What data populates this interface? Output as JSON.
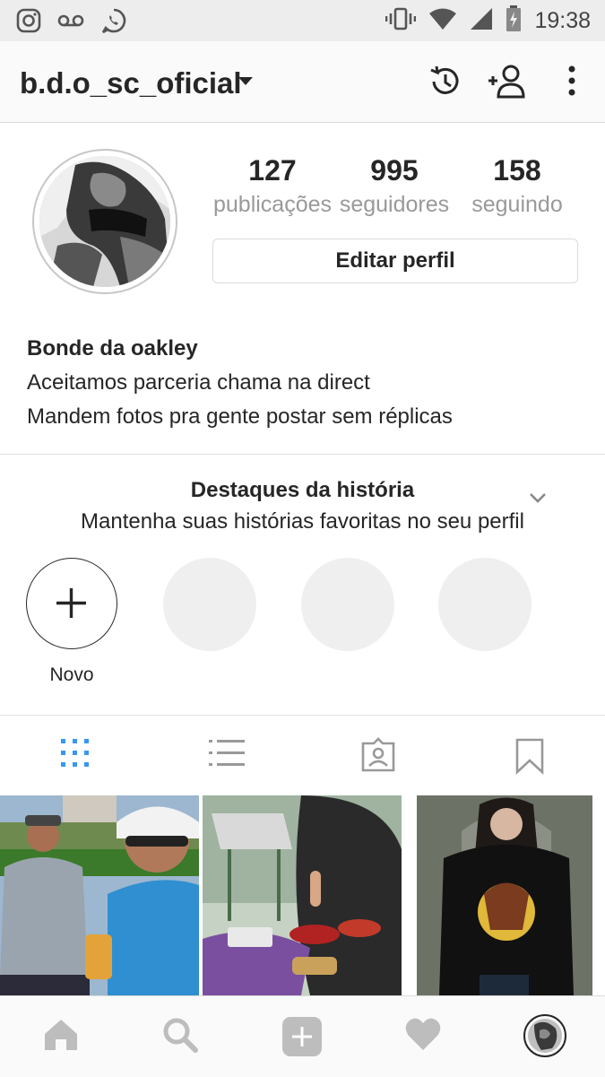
{
  "status_bar": {
    "time": "19:38",
    "left_icons": [
      "instagram-icon",
      "voicemail-icon",
      "whatsapp-icon"
    ],
    "right_icons": [
      "vibrate-icon",
      "wifi-icon",
      "signal-icon",
      "battery-icon"
    ]
  },
  "toolbar": {
    "username": "b.d.o_sc_oficial",
    "icons": [
      "account-switch-caret-icon",
      "archive-history-icon",
      "add-person-icon",
      "more-options-icon"
    ]
  },
  "profile": {
    "stats": [
      {
        "count": "127",
        "label": "publicações"
      },
      {
        "count": "995",
        "label": "seguidores"
      },
      {
        "count": "158",
        "label": "seguindo"
      }
    ],
    "edit_button": "Editar perfil",
    "display_name": "Bonde da oakley",
    "bio_lines": [
      "Aceitamos parceria chama na direct",
      "Mandem fotos pra gente postar sem réplicas"
    ]
  },
  "highlights": {
    "title": "Destaques da história",
    "subtitle": "Mantenha suas histórias favoritas no seu perfil",
    "new_label": "Novo"
  },
  "tabs": [
    "grid-view",
    "list-view",
    "tagged",
    "saved"
  ],
  "colors": {
    "accent": "#3897f0",
    "text": "#262626",
    "muted": "#999999",
    "divider": "#dbdbdb"
  },
  "bottom_nav": [
    "home-icon",
    "search-icon",
    "add-post-icon",
    "activity-heart-icon",
    "profile-avatar-icon"
  ]
}
